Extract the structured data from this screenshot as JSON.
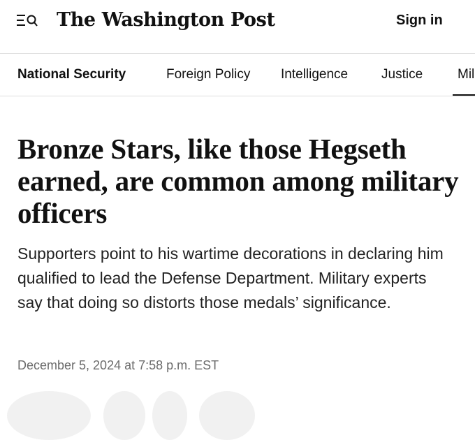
{
  "header": {
    "menu_search_icon": "menu-search-icon",
    "logo_text": "The Washington Post",
    "signin_label": "Sign in"
  },
  "nav": {
    "items": [
      {
        "label": "National Security",
        "active": true
      },
      {
        "label": "Foreign Policy",
        "active": false
      },
      {
        "label": "Intelligence",
        "active": false
      },
      {
        "label": "Justice",
        "active": false
      },
      {
        "label": "Mil",
        "active": false
      }
    ]
  },
  "article": {
    "headline": "Bronze Stars, like those Hegseth earned, are common among military officers",
    "dek": "Supporters point to his wartime decorations in declaring him qualified to lead the Defense Department. Military experts say that doing so distorts those medals’ significance.",
    "dateline": "December 5, 2024 at 7:58 p.m. EST"
  }
}
